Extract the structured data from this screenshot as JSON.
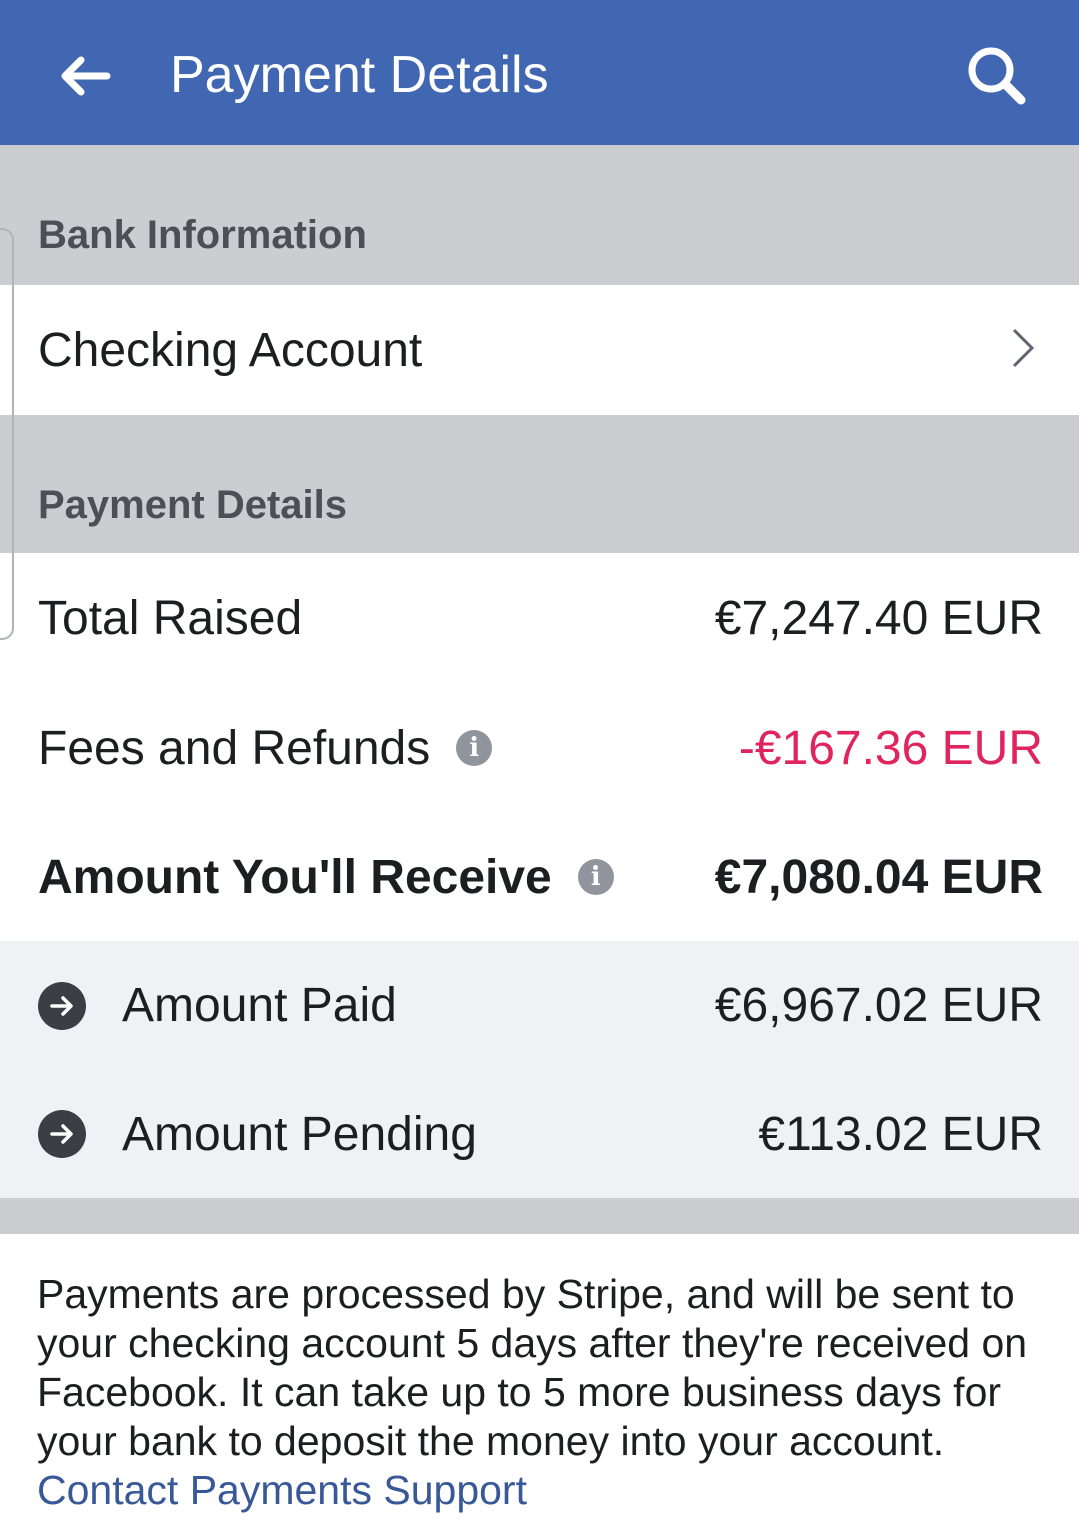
{
  "header": {
    "title": "Payment Details",
    "background_color": "#4267b2",
    "back_icon": "back-arrow-icon",
    "search_icon": "search-icon"
  },
  "bank_section": {
    "heading": "Bank Information",
    "account_label": "Checking Account",
    "chevron_icon": "chevron-right-icon"
  },
  "payment_section": {
    "heading": "Payment Details",
    "rows": [
      {
        "label": "Total Raised",
        "value": "€7,247.40 EUR"
      },
      {
        "label": "Fees and Refunds",
        "value": "-€167.36 EUR",
        "value_color": "#e0245e"
      },
      {
        "label": "Amount You'll Receive",
        "value": "€7,080.04 EUR"
      }
    ],
    "sub_rows": [
      {
        "label": "Amount Paid",
        "value": "€6,967.02 EUR"
      },
      {
        "label": "Amount Pending",
        "value": "€113.02 EUR"
      }
    ]
  },
  "footer": {
    "text": "Payments are processed by Stripe, and will be sent to your checking account 5 days after they're received on Facebook. It can take up to 5 more business days for your bank to deposit the money into your account.",
    "link": "Contact Payments Support",
    "link_color": "#385898"
  }
}
